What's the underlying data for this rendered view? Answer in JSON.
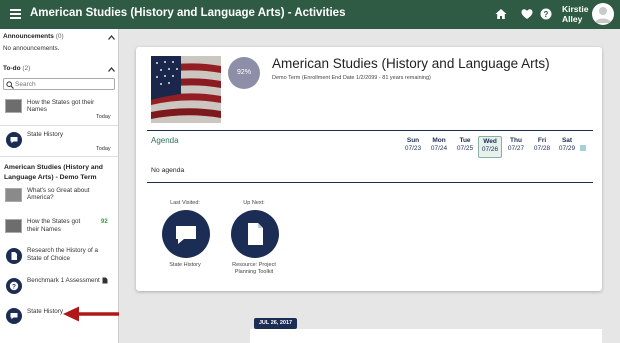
{
  "header": {
    "title": "American Studies (History and Language Arts) - Activities",
    "user_name_line1": "Kirstie",
    "user_name_line2": "Alley"
  },
  "sidebar": {
    "announcements": {
      "label": "Announcements",
      "count": "(0)",
      "empty_text": "No announcements."
    },
    "todo": {
      "label": "To-do",
      "count": "(2)",
      "search_placeholder": "Search",
      "items": [
        {
          "title": "How the States got their Names",
          "due": "Today"
        },
        {
          "title": "State History",
          "due": "Today"
        }
      ]
    },
    "course": {
      "title": "American Studies (History and Language Arts) - Demo Term",
      "items": [
        {
          "title": "What's so Great about America?"
        },
        {
          "title": "How the States got their Names",
          "score": "92"
        },
        {
          "title": "Research the History of a State of Choice"
        },
        {
          "title": "Benchmark 1 Assessment"
        },
        {
          "title": "State History"
        }
      ]
    }
  },
  "course_card": {
    "grade": "92%",
    "title": "American Studies (History and Language Arts)",
    "subtitle": "Demo Term (Enrollment End Date 1/2/2099 - 81 years remaining)",
    "agenda_label": "Agenda",
    "no_agenda": "No agenda",
    "days": [
      {
        "name": "Sun",
        "date": "07/23"
      },
      {
        "name": "Mon",
        "date": "07/24"
      },
      {
        "name": "Tue",
        "date": "07/25"
      },
      {
        "name": "Wed",
        "date": "07/26"
      },
      {
        "name": "Thu",
        "date": "07/27"
      },
      {
        "name": "Fri",
        "date": "07/28"
      },
      {
        "name": "Sat",
        "date": "07/29"
      }
    ],
    "last_visited": {
      "label": "Last Visited:",
      "title": "State History"
    },
    "up_next": {
      "label": "Up Next:",
      "title_line1": "Resource: Project",
      "title_line2": "Planning Toolkit"
    }
  },
  "feed": {
    "date_badge": "JUL 26, 2017"
  },
  "colors": {
    "header_green": "#2f5b44",
    "navy": "#1b2c55",
    "arrow_red": "#b01818",
    "score_green": "#3a9a3a"
  }
}
